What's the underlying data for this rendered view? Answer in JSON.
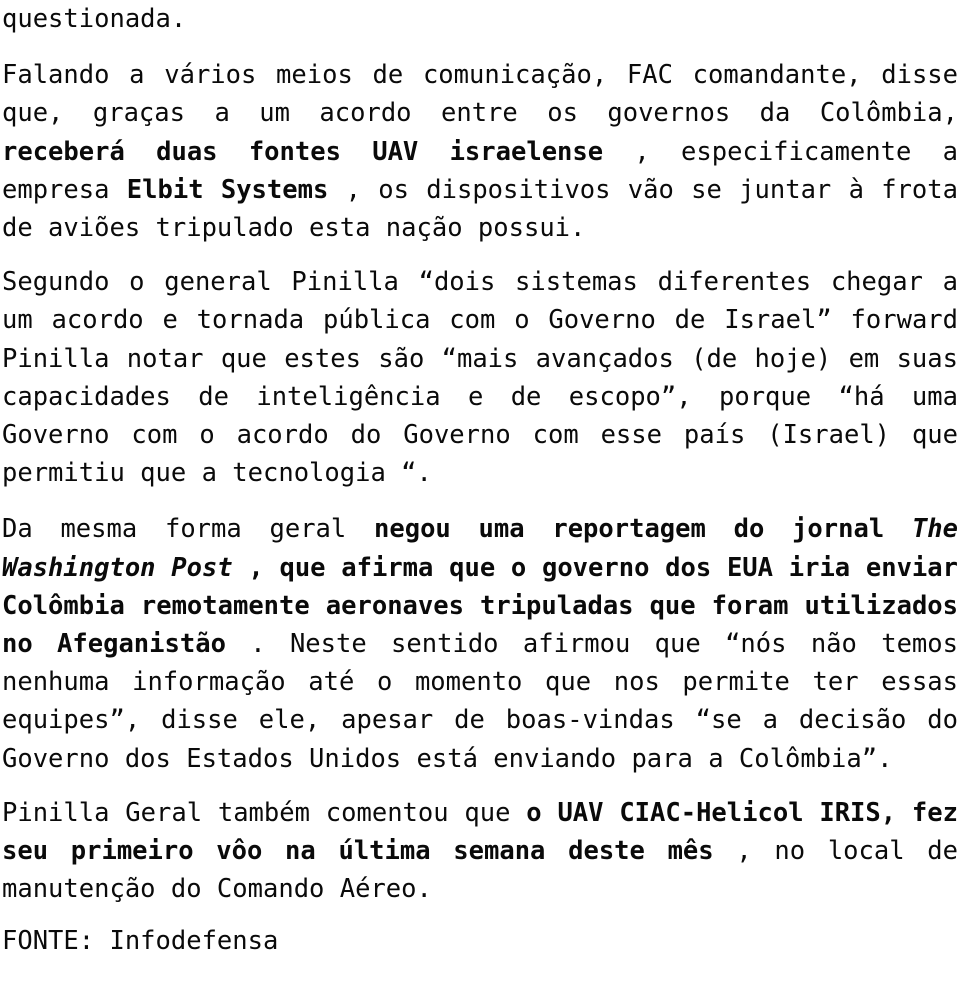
{
  "document": {
    "text_color": "#0a0a0a",
    "background_color": "#ffffff",
    "orphan_line": "questionada.",
    "paragraphs": [
      {
        "id": "p1",
        "segments": [
          {
            "style": "regular",
            "text": "Falando a vários meios de comunicação, FAC comandante, disse que, graças a um acordo entre os governos da Colômbia, "
          },
          {
            "style": "bold",
            "text": "receberá duas fontes UAV israelense"
          },
          {
            "style": "regular",
            "text": " , especificamente a empresa "
          },
          {
            "style": "bold",
            "text": "Elbit Systems"
          },
          {
            "style": "regular",
            "text": " , os dispositivos vão se juntar à frota de aviões tripulado esta nação possui."
          }
        ]
      },
      {
        "id": "p2",
        "segments": [
          {
            "style": "regular",
            "text": "Segundo o general Pinilla “dois sistemas diferentes chegar a um acordo e tornada pública com o Governo de Israel” forward Pinilla notar que estes são “mais avançados (de hoje) em suas capacidades de inteligência e de escopo”, porque “há uma Governo com o acordo do Governo com esse país (Israel) que permitiu que a tecnologia “."
          }
        ]
      },
      {
        "id": "p3",
        "segments": [
          {
            "style": "regular",
            "text": "Da mesma forma geral "
          },
          {
            "style": "bold",
            "text": "negou uma reportagem do jornal "
          },
          {
            "style": "bold-italic",
            "text": "The Washington Post"
          },
          {
            "style": "bold",
            "text": " , que afirma que o governo dos EUA iria enviar Colômbia remotamente aeronaves tripuladas que foram utilizados no Afeganistão"
          },
          {
            "style": "regular",
            "text": " . Neste sentido afirmou que “nós não temos nenhuma informação até o momento que nos permite ter essas equipes”, disse ele, apesar de boas-vindas “se a decisão do Governo dos Estados Unidos está enviando para a Colômbia”."
          }
        ]
      },
      {
        "id": "p4",
        "segments": [
          {
            "style": "regular",
            "text": "Pinilla Geral também comentou que "
          },
          {
            "style": "bold",
            "text": "o UAV CIAC-Helicol IRIS, fez seu primeiro vôo na última semana deste mês"
          },
          {
            "style": "regular",
            "text": " , no local de manutenção do Comando Aéreo."
          }
        ]
      }
    ],
    "source_line": "FONTE: Infodefensa"
  }
}
